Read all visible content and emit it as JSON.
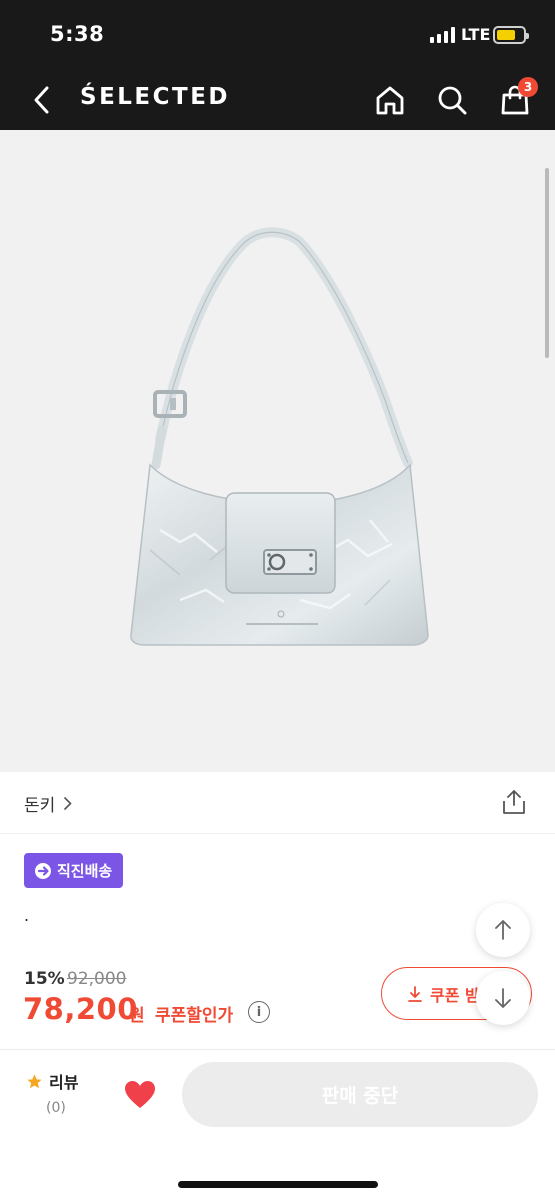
{
  "status_bar": {
    "time": "5:38",
    "network": "LTE",
    "icons": [
      "signal-icon",
      "battery-icon"
    ],
    "battery_color": "#f5d000"
  },
  "header": {
    "brand": "ŚELECTED",
    "cart_count": "3",
    "icons": [
      "back-arrow-icon",
      "home-icon",
      "search-icon",
      "shopping-bag-icon"
    ],
    "background": "#191919"
  },
  "product": {
    "brand_link": "돈키",
    "badge": "직진배송",
    "name": ".",
    "discount_rate": "15%",
    "original_price": "92,000",
    "sale_price": "78,200",
    "currency": "원",
    "coupon_label": "쿠폰할인가",
    "coupon_button": "쿠폰 받",
    "info_icon_text": "i",
    "accent_color": "#f04a35",
    "badge_color": "#7b56e6"
  },
  "bottom_bar": {
    "review_label": "리뷰",
    "review_count": "(0)",
    "sold_out_label": "판매 중단",
    "wish_color": "#f0404a"
  }
}
